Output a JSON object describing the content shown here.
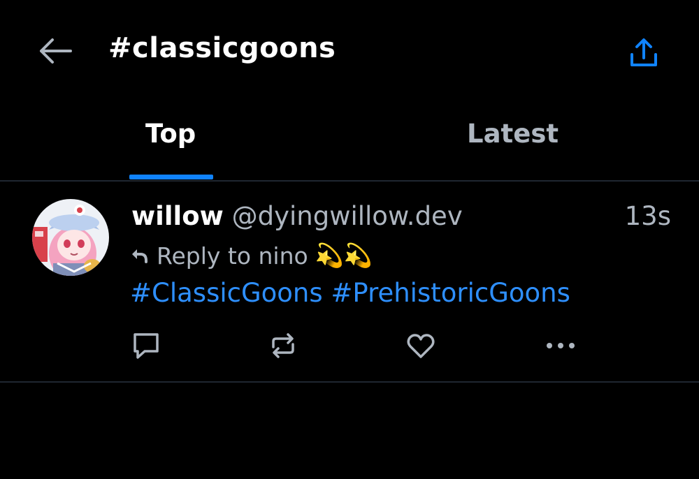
{
  "header": {
    "title": "#classicgoons",
    "back_icon": "arrow-left-icon",
    "share_icon": "share-upload-icon"
  },
  "tabs": [
    {
      "label": "Top",
      "active": true
    },
    {
      "label": "Latest",
      "active": false
    }
  ],
  "post": {
    "author_name": "willow",
    "author_handle": "@dyingwillow.dev",
    "time": "13s",
    "reply_to": "Reply to nino",
    "reply_emoji": "💫💫",
    "hashtags": [
      "#ClassicGoons",
      "#PrehistoricGoons"
    ],
    "actions": [
      "reply-icon",
      "repost-icon",
      "like-icon",
      "more-icon"
    ]
  },
  "colors": {
    "background": "#000000",
    "accent": "#1083fe",
    "link": "#2e8ffe",
    "muted": "#aeb6c0",
    "divider": "#1f2731"
  }
}
